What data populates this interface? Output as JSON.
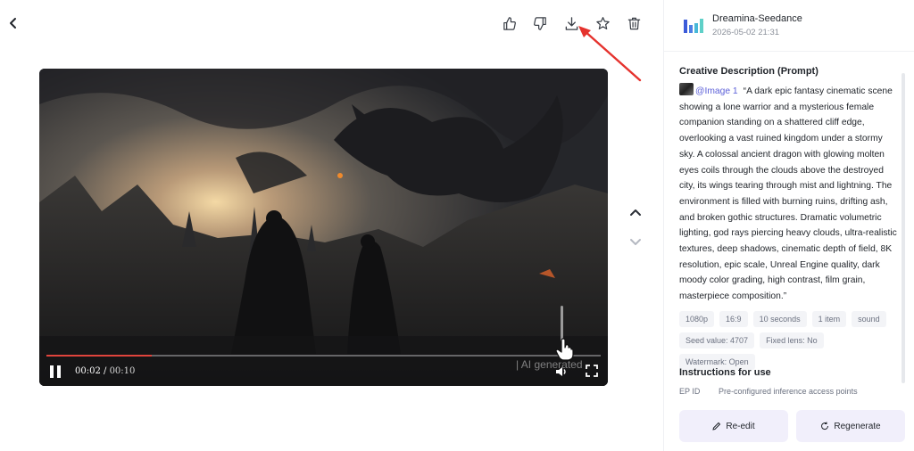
{
  "toolbar": {
    "icons": [
      "thumbs-up-icon",
      "thumbs-down-icon",
      "download-icon",
      "star-icon",
      "trash-icon"
    ]
  },
  "player": {
    "current_time": "00:02",
    "separator": " / ",
    "duration": "00:10",
    "progress_fraction": 0.19,
    "watermark": "AI generated"
  },
  "panel": {
    "model_name": "Dreamina-Seedance",
    "date": "2026-05-02 21:31",
    "prompt_title": "Creative Description (Prompt)",
    "image_ref": "@Image 1",
    "prompt_text": "“A dark epic fantasy cinematic scene showing a lone warrior and a mysterious female companion standing on a shattered cliff edge, overlooking a vast ruined kingdom under a stormy sky. A colossal ancient dragon with glowing molten eyes coils through the clouds above the destroyed city, its wings tearing through mist and lightning. The environment is filled with burning ruins, drifting ash, and broken gothic structures. Dramatic volumetric lighting, god rays piercing heavy clouds, ultra-realistic textures, deep shadows, cinematic depth of field, 8K resolution, epic scale, Unreal Engine quality, dark moody color grading, high contrast, film grain, masterpiece composition.”",
    "tags_row1": [
      "1080p",
      "16:9",
      "10 seconds",
      "1 item",
      "sound"
    ],
    "tags_row2": [
      "Seed value: 4707",
      "Fixed lens: No",
      "Watermark: Open"
    ],
    "instructions_title": "Instructions for use",
    "ep_label": "EP ID",
    "ep_value": "Pre-configured inference access points",
    "reedit_label": "Re-edit",
    "regenerate_label": "Regenerate"
  },
  "colors": {
    "accent": "#5b5fd8",
    "progress": "#e0443c",
    "annotation_arrow": "#e5322d",
    "button_bg": "#f1effb"
  }
}
